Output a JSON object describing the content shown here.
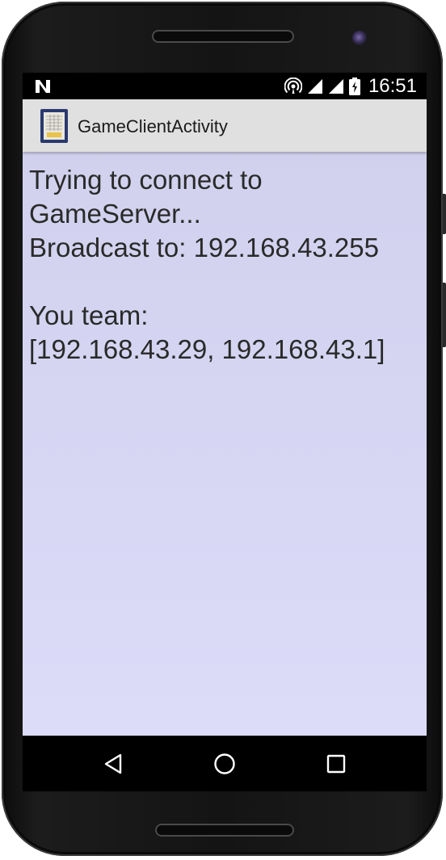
{
  "status_bar": {
    "time": "16:51",
    "icons": [
      "notification-n-icon",
      "hotspot-icon",
      "cell-signal-icon",
      "wifi-signal-icon",
      "battery-icon"
    ]
  },
  "action_bar": {
    "title": "GameClientActivity",
    "icon": "app-icon"
  },
  "content": {
    "text": "Trying to connect to\nGameServer...\nBroadcast to: 192.168.43.255\n\nYou team:\n[192.168.43.29, 192.168.43.1]"
  },
  "nav_bar": {
    "buttons": [
      "back-icon",
      "home-icon",
      "recents-icon"
    ]
  },
  "colors": {
    "content_background_top": "#d1d1ee",
    "content_background_bottom": "#dcdcf9",
    "action_bar": "#e0e0e0",
    "text": "#2a2a2a"
  }
}
